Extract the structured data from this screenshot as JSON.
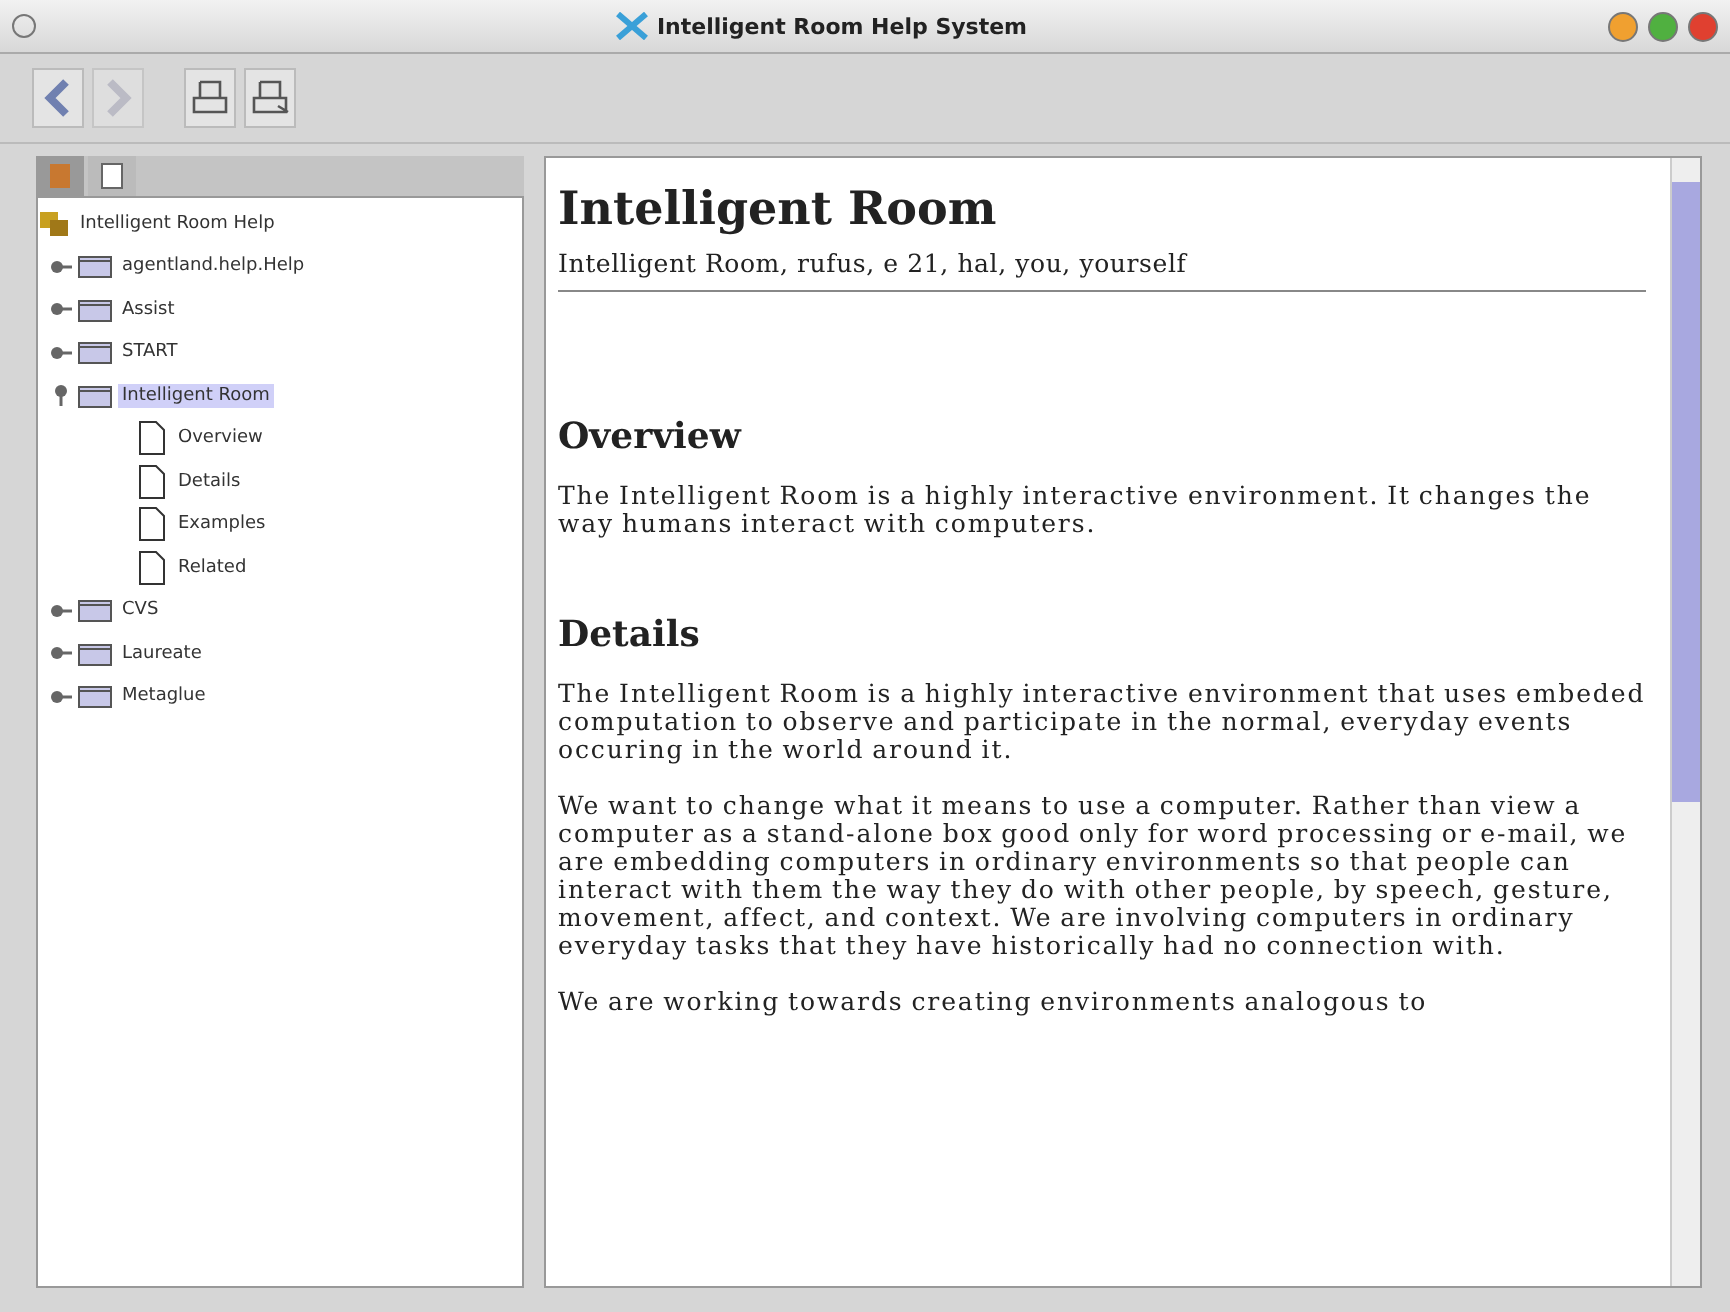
{
  "window": {
    "title": "Intelligent Room Help System"
  },
  "toolbar": {
    "buttons": [
      {
        "kind": "back",
        "disabled": false
      },
      {
        "kind": "forward",
        "disabled": true
      },
      {
        "kind": "print",
        "disabled": false
      },
      {
        "kind": "page-setup",
        "disabled": false
      }
    ]
  },
  "navigator": {
    "tabs": [
      {
        "kind": "contents",
        "selected": true
      },
      {
        "kind": "index",
        "selected": false
      }
    ],
    "tree": {
      "label": "Intelligent Room Help",
      "children": [
        {
          "label": "agentland.help.Help",
          "kind": "folder",
          "expanded": false,
          "selected": false
        },
        {
          "label": "Assist",
          "kind": "folder",
          "expanded": false,
          "selected": false
        },
        {
          "label": "START",
          "kind": "folder",
          "expanded": false,
          "selected": false
        },
        {
          "label": "Intelligent Room",
          "kind": "folder",
          "expanded": true,
          "selected": true,
          "children": [
            {
              "label": "Overview",
              "kind": "page",
              "selected": false
            },
            {
              "label": "Details",
              "kind": "page",
              "selected": false
            },
            {
              "label": "Examples",
              "kind": "page",
              "selected": false
            },
            {
              "label": "Related",
              "kind": "page",
              "selected": false
            }
          ]
        },
        {
          "label": "CVS",
          "kind": "folder",
          "expanded": false,
          "selected": false
        },
        {
          "label": "Laureate",
          "kind": "folder",
          "expanded": false,
          "selected": false
        },
        {
          "label": "Metaglue",
          "kind": "folder",
          "expanded": false,
          "selected": false
        }
      ]
    }
  },
  "content": {
    "title": "Intelligent Room",
    "keywords": "Intelligent Room, rufus, e 21, hal, you, yourself",
    "sections": [
      {
        "heading": "Overview",
        "paragraphs": [
          "The Intelligent Room is a highly interactive environment. It changes the way humans interact with computers."
        ]
      },
      {
        "heading": "Details",
        "paragraphs": [
          "The Intelligent Room is a highly interactive environment that uses embeded computation to observe and participate in the normal, everyday events occuring in the world around it.",
          "We want to change what it means to use a computer. Rather than view a computer as a stand-alone box good only for word processing or e-mail, we are embedding computers in ordinary environments so that people can interact with them the way they do with other people, by speech, gesture, movement, affect, and context. We are involving computers in ordinary everyday tasks that they have historically had no connection with.",
          "We are working towards creating environments analogous to"
        ]
      }
    ]
  }
}
